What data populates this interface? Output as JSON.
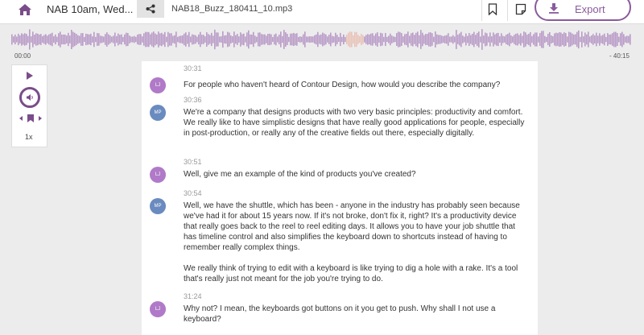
{
  "topbar": {
    "title": "NAB 10am, Wed...",
    "filename": "NAB18_Buzz_180411_10.mp3",
    "export_label": "Export"
  },
  "player": {
    "time_start": "00:00",
    "time_end": "- 40:15",
    "speed": "1x"
  },
  "entries": [
    {
      "time": "30:31",
      "speaker": "LJ",
      "text": "For people who haven't heard of Contour Design, how would you describe the company?"
    },
    {
      "time": "30:36",
      "speaker": "MP",
      "text": "We're a company that designs products with two very basic principles: productivity and comfort. We really like to have simplistic designs that have really good applications for people, especially in post-production, or really any of the creative fields out there, especially digitally."
    },
    {
      "time": "30:51",
      "speaker": "LJ",
      "text": "Well, give me an example of the kind of products you've created?"
    },
    {
      "time": "30:54",
      "speaker": "MP",
      "text": "Well, we have the shuttle, which has been - anyone in the industry has probably seen because we've had it for about 15 years now. If it's not broke, don't fix it, right? It's a productivity device that really goes back to the reel to reel editing days. It allows you to have your job shuttle that has timeline control and also simplifies the keyboard down to shortcuts instead of having to remember really complex things.",
      "text2": "We really think of trying to edit with a keyboard is like trying to dig a hole with a rake. It's a tool that's really just not meant for the job you're trying to do."
    },
    {
      "time": "31:24",
      "speaker": "LJ",
      "text": "Why not? I mean, the keyboards got buttons on it you get to push. Why shall I not use a keyboard?"
    }
  ],
  "colors": {
    "accent": "#8a5a9c",
    "waveform": "#b99bc7",
    "speaker_lj": "#b07ac8",
    "speaker_mp": "#6a8bbf"
  },
  "icons": {
    "home": "home-icon",
    "share": "share-icon",
    "bookmark": "bookmark-icon",
    "note": "note-icon",
    "export": "download-icon",
    "play": "play-icon",
    "volume": "volume-icon"
  }
}
